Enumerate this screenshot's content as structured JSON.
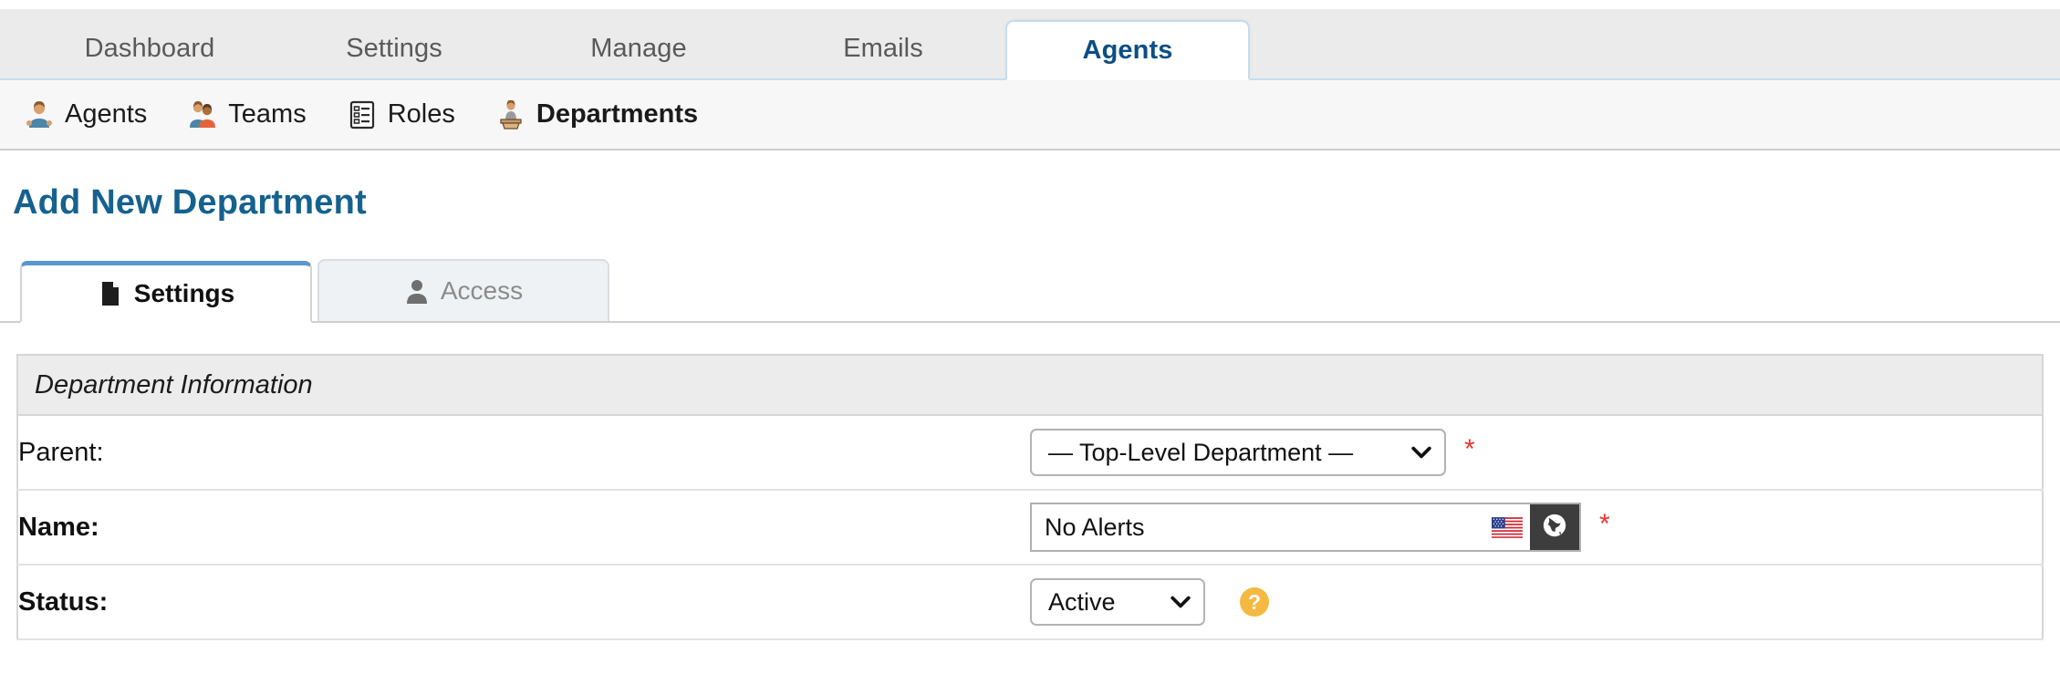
{
  "primary_nav": {
    "tabs": [
      {
        "label": "Dashboard",
        "active": false
      },
      {
        "label": "Settings",
        "active": false
      },
      {
        "label": "Manage",
        "active": false
      },
      {
        "label": "Emails",
        "active": false
      },
      {
        "label": "Agents",
        "active": true
      }
    ]
  },
  "sub_nav": {
    "items": [
      {
        "label": "Agents",
        "icon": "agent-person-icon",
        "active": false
      },
      {
        "label": "Teams",
        "icon": "teams-people-icon",
        "active": false
      },
      {
        "label": "Roles",
        "icon": "roles-list-icon",
        "active": false
      },
      {
        "label": "Departments",
        "icon": "departments-podium-icon",
        "active": true
      }
    ]
  },
  "page": {
    "title": "Add New Department"
  },
  "inner_tabs": [
    {
      "label": "Settings",
      "icon": "document-icon",
      "active": true
    },
    {
      "label": "Access",
      "icon": "person-icon",
      "active": false
    }
  ],
  "form": {
    "section_title": "Department Information",
    "rows": {
      "parent": {
        "label": "Parent:",
        "value": "— Top-Level Department —",
        "required_marker": "*",
        "options": [
          "— Top-Level Department —"
        ]
      },
      "name": {
        "label": "Name:",
        "value": "No Alerts",
        "placeholder": "",
        "flag_icon": "us-flag-icon",
        "translate_icon": "globe-icon",
        "required_marker": "*"
      },
      "status": {
        "label": "Status:",
        "value": "Active",
        "options": [
          "Active"
        ],
        "help_icon": "question-help-icon",
        "help_label": "?"
      }
    }
  },
  "colors": {
    "accent_blue": "#15618f",
    "tab_active_text": "#0c4e86",
    "tab_top_highlight": "#5b97cd",
    "required_red": "#e8352b",
    "help_orange": "#f5b941",
    "translate_button_bg": "#3d3d3d"
  }
}
